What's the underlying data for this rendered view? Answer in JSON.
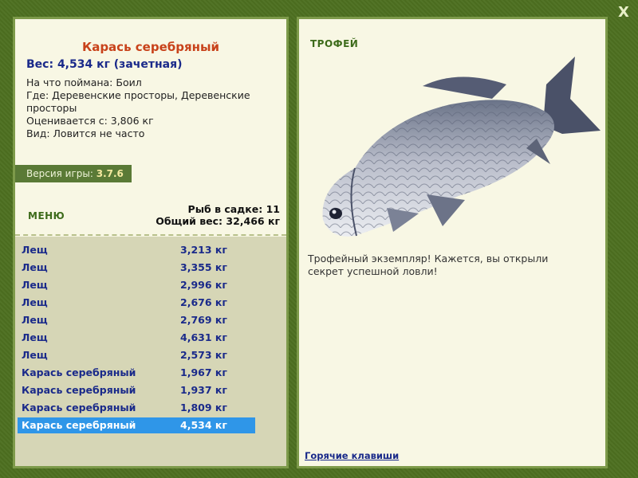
{
  "window": {
    "close_label": "X"
  },
  "fish": {
    "title": "Карась серебряный",
    "weight_line": "Вес: 4,534 кг (зачетная)",
    "caught_on": "На что поймана: Боил",
    "where": "Где: Деревенские просторы, Деревенские просторы",
    "valued_from": "Оценивается с: 3,806 кг",
    "kind": "Вид: Ловится не часто"
  },
  "version": {
    "label": "Версия игры: ",
    "value": "3.7.6"
  },
  "menu": {
    "label": "МЕНЮ"
  },
  "keep": {
    "count_line": "Рыб в садке: 11",
    "total_line": "Общий вес: 32,466 кг"
  },
  "catch_list": [
    {
      "name": "Лещ",
      "weight": "3,213 кг",
      "selected": false
    },
    {
      "name": "Лещ",
      "weight": "3,355 кг",
      "selected": false
    },
    {
      "name": "Лещ",
      "weight": "2,996 кг",
      "selected": false
    },
    {
      "name": "Лещ",
      "weight": "2,676 кг",
      "selected": false
    },
    {
      "name": "Лещ",
      "weight": "2,769 кг",
      "selected": false
    },
    {
      "name": "Лещ",
      "weight": "4,631 кг",
      "selected": false
    },
    {
      "name": "Лещ",
      "weight": "2,573 кг",
      "selected": false
    },
    {
      "name": "Карась серебряный",
      "weight": "1,967 кг",
      "selected": false
    },
    {
      "name": "Карась серебряный",
      "weight": "1,937 кг",
      "selected": false
    },
    {
      "name": "Карась серебряный",
      "weight": "1,809 кг",
      "selected": false
    },
    {
      "name": "Карась серебряный",
      "weight": "4,534 кг",
      "selected": true
    }
  ],
  "trophy": {
    "label": "ТРОФЕЙ",
    "text": "Трофейный экземпляр! Кажется, вы открыли секрет успешной ловли!"
  },
  "hotkeys": {
    "label": "Горячие клавиши"
  },
  "colors": {
    "accent": "#3d6b1a",
    "selected_row": "#2f96e8",
    "title": "#c8421a",
    "link": "#1a2a8a"
  }
}
